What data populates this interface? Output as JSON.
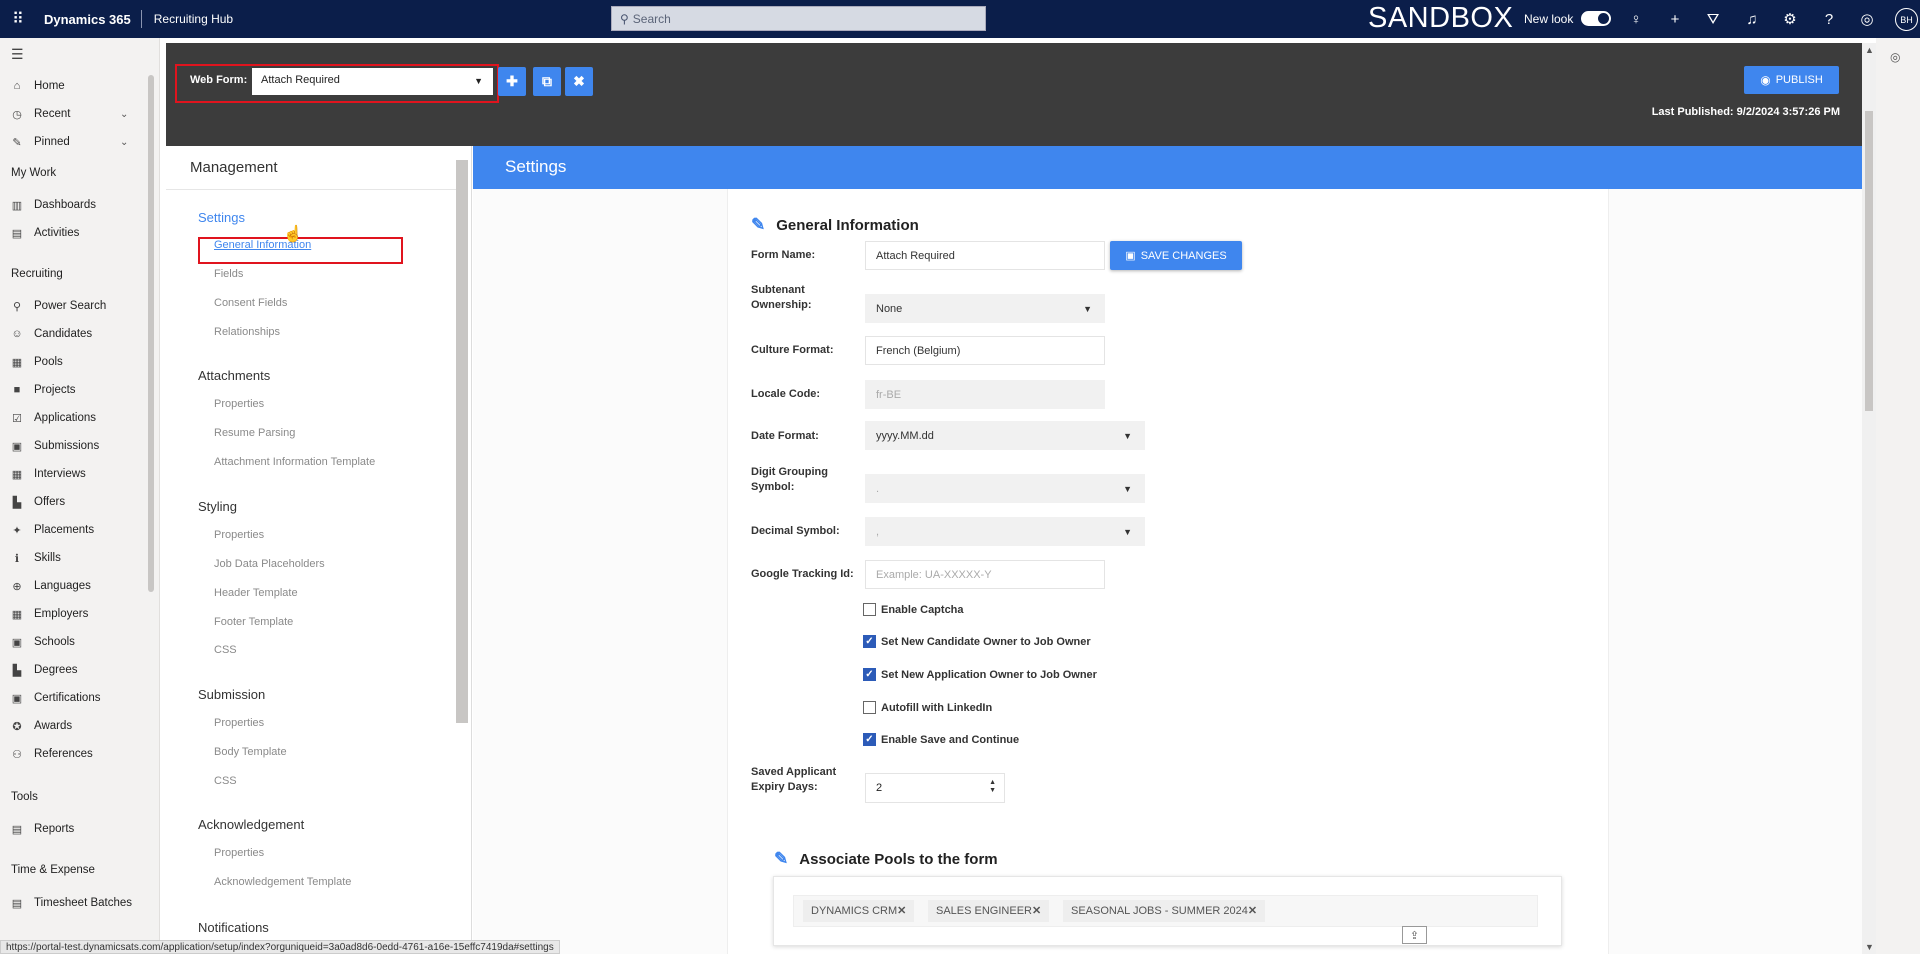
{
  "topbar": {
    "brand": "Dynamics 365",
    "app": "Recruiting Hub",
    "search_placeholder": "Search",
    "env": "SANDBOX",
    "new_look": "New look",
    "avatar": "BH"
  },
  "nav": {
    "items": [
      {
        "label": "Home",
        "icon": "home-icon",
        "glyph": "⌂"
      },
      {
        "label": "Recent",
        "icon": "clock-icon",
        "glyph": "◷"
      },
      {
        "label": "Pinned",
        "icon": "pin-icon",
        "glyph": "✎"
      }
    ],
    "my_work": "My Work",
    "my_work_items": [
      {
        "label": "Dashboards",
        "glyph": "▥"
      },
      {
        "label": "Activities",
        "glyph": "▤"
      }
    ],
    "recruiting": "Recruiting",
    "recruiting_items": [
      {
        "label": "Power Search",
        "glyph": "⚲"
      },
      {
        "label": "Candidates",
        "glyph": "☺"
      },
      {
        "label": "Pools",
        "glyph": "▦"
      },
      {
        "label": "Projects",
        "glyph": "■"
      },
      {
        "label": "Applications",
        "glyph": "☑"
      },
      {
        "label": "Submissions",
        "glyph": "▣"
      },
      {
        "label": "Interviews",
        "glyph": "▦"
      },
      {
        "label": "Offers",
        "glyph": "▙"
      },
      {
        "label": "Placements",
        "glyph": "✦"
      },
      {
        "label": "Skills",
        "glyph": "ℹ"
      },
      {
        "label": "Languages",
        "glyph": "⊕"
      },
      {
        "label": "Employers",
        "glyph": "▦"
      },
      {
        "label": "Schools",
        "glyph": "▣"
      },
      {
        "label": "Degrees",
        "glyph": "▙"
      },
      {
        "label": "Certifications",
        "glyph": "▣"
      },
      {
        "label": "Awards",
        "glyph": "✪"
      },
      {
        "label": "References",
        "glyph": "⚇"
      }
    ],
    "tools": "Tools",
    "tools_items": [
      {
        "label": "Reports",
        "glyph": "▤"
      }
    ],
    "time_expense": "Time & Expense",
    "time_items": [
      {
        "label": "Timesheet Batches",
        "glyph": "▤"
      }
    ]
  },
  "header": {
    "web_form_label": "Web Form:",
    "web_form_value": "Attach Required",
    "publish": "PUBLISH",
    "last_published": "Last Published: 9/2/2024 3:57:26 PM"
  },
  "management": {
    "title": "Management",
    "groups": [
      {
        "head": "Settings",
        "items": [
          "General Information",
          "Fields",
          "Consent Fields",
          "Relationships"
        ]
      },
      {
        "head": "Attachments",
        "items": [
          "Properties",
          "Resume Parsing",
          "Attachment Information Template"
        ]
      },
      {
        "head": "Styling",
        "items": [
          "Properties",
          "Job Data Placeholders",
          "Header Template",
          "Footer Template",
          "CSS"
        ]
      },
      {
        "head": "Submission",
        "items": [
          "Properties",
          "Body Template",
          "CSS"
        ]
      },
      {
        "head": "Acknowledgement",
        "items": [
          "Properties",
          "Acknowledgement Template"
        ]
      },
      {
        "head": "Notifications",
        "items": []
      }
    ]
  },
  "settings": {
    "bar_title": "Settings",
    "general_title": "General Information",
    "save": "SAVE CHANGES",
    "form_name_label": "Form Name:",
    "form_name": "Attach Required",
    "subtenant_label": "Subtenant Ownership:",
    "subtenant": "None",
    "culture_label": "Culture Format:",
    "culture": "French (Belgium)",
    "locale_label": "Locale Code:",
    "locale": "fr-BE",
    "date_label": "Date Format:",
    "date": "yyyy.MM.dd",
    "digit_label": "Digit Grouping Symbol:",
    "digit": ".",
    "decimal_label": "Decimal Symbol:",
    "decimal": ",",
    "tracking_label": "Google Tracking Id:",
    "tracking_placeholder": "Example: UA-XXXXX-Y",
    "checkboxes": [
      {
        "label": "Enable Captcha",
        "checked": false
      },
      {
        "label": "Set New Candidate Owner to Job Owner",
        "checked": true
      },
      {
        "label": "Set New Application Owner to Job Owner",
        "checked": true
      },
      {
        "label": "Autofill with LinkedIn",
        "checked": false
      },
      {
        "label": "Enable Save and Continue",
        "checked": true
      }
    ],
    "expiry_label": "Saved Applicant Expiry Days:",
    "expiry": "2",
    "pools_title": "Associate Pools to the form",
    "pools": [
      "DYNAMICS CRM",
      "SALES ENGINEER",
      "SEASONAL JOBS - SUMMER 2024"
    ]
  },
  "status_url": "https://portal-test.dynamicsats.com/application/setup/index?orguniqueid=3a0ad8d6-0edd-4761-a16e-15effc7419da#settings"
}
